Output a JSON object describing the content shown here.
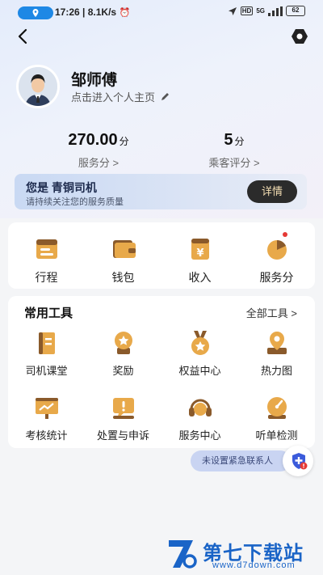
{
  "status_bar": {
    "time": "17:26",
    "speed": "8.1K/s",
    "battery": "62",
    "network": "5G"
  },
  "profile": {
    "name": "邹师傅",
    "subtitle": "点击进入个人主页"
  },
  "stats": [
    {
      "value": "270.00",
      "unit": "分",
      "label": "服务分 >"
    },
    {
      "value": "5",
      "unit": "分",
      "label": "乘客评分 >"
    }
  ],
  "level": {
    "title": "您是 青铜司机",
    "subtitle": "请持续关注您的服务质量",
    "button": "详情"
  },
  "quick_actions": [
    {
      "label": "行程",
      "icon": "trip-icon"
    },
    {
      "label": "钱包",
      "icon": "wallet-icon"
    },
    {
      "label": "收入",
      "icon": "income-icon"
    },
    {
      "label": "服务分",
      "icon": "service-score-icon"
    }
  ],
  "tools": {
    "heading": "常用工具",
    "all_label": "全部工具 >",
    "items": [
      {
        "label": "司机课堂",
        "icon": "classroom-icon"
      },
      {
        "label": "奖励",
        "icon": "reward-icon"
      },
      {
        "label": "权益中心",
        "icon": "benefits-icon"
      },
      {
        "label": "热力图",
        "icon": "heatmap-icon"
      },
      {
        "label": "考核统计",
        "icon": "stats-icon"
      },
      {
        "label": "处置与申诉",
        "icon": "appeal-icon"
      },
      {
        "label": "服务中心",
        "icon": "headset-icon"
      },
      {
        "label": "听单检测",
        "icon": "gauge-icon"
      }
    ]
  },
  "emergency": {
    "label": "未设置紧急联系人"
  },
  "watermark": {
    "title": "第七下载站",
    "url": "www.d7down.com"
  },
  "colors": {
    "accent": "#1e88e5",
    "icon_gold": "#e8a94a",
    "icon_brown": "#8a5a2b",
    "detail_btn_bg": "#2b2b2b",
    "detail_btn_text": "#f5dfb4"
  }
}
